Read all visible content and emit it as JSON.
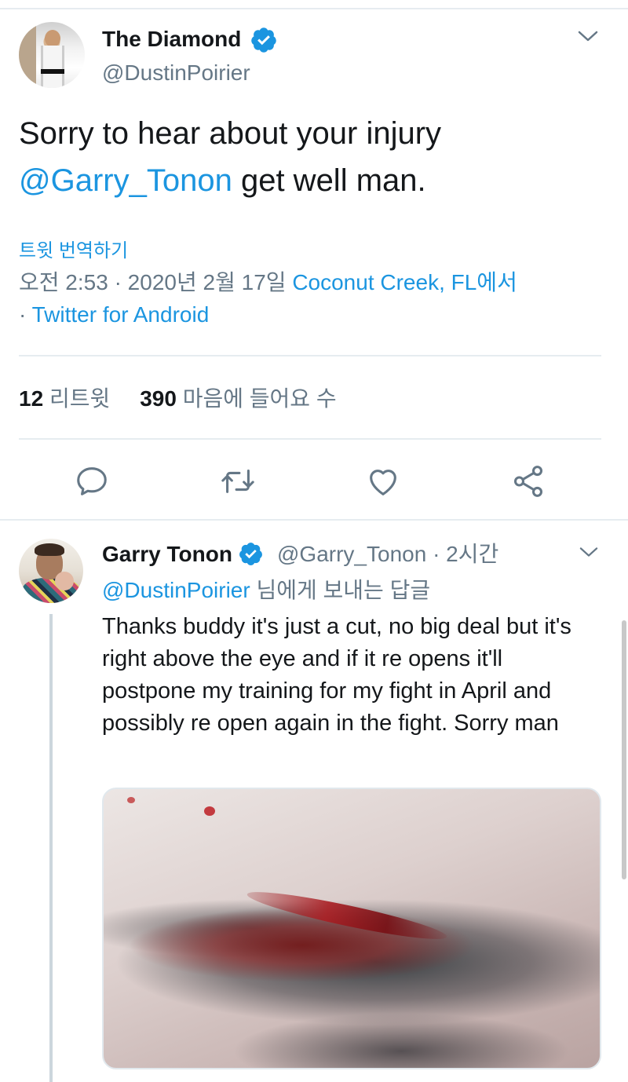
{
  "main_tweet": {
    "display_name": "The Diamond",
    "handle": "@DustinPoirier",
    "text_part1": "Sorry to hear about your injury ",
    "mention": "@Garry_Tonon",
    "text_part2": " get well man.",
    "translate_label": "트윗 번역하기",
    "timestamp": "오전 2:53 · 2020년 2월 17일 ",
    "location": "Coconut Creek, FL에서",
    "source_prefix": " · ",
    "source": "Twitter for Android",
    "retweets_count": "12",
    "retweets_label": "리트윗",
    "likes_count": "390",
    "likes_label": "마음에 들어요 수"
  },
  "reply_tweet": {
    "display_name": "Garry Tonon",
    "handle_time": "@Garry_Tonon · 2시간",
    "replying_to_mention": "@DustinPoirier",
    "replying_to_suffix": " 님에게 보내는 답글",
    "text": "Thanks buddy it's just a cut, no big deal but it's right above the eye and if it re opens it'll postpone my training for my fight in April and possibly re open again in the fight. Sorry man"
  },
  "icons": {
    "verified": "verified-badge-icon",
    "caret": "chevron-down-icon",
    "reply": "reply-icon",
    "retweet": "retweet-icon",
    "like": "heart-icon",
    "share": "share-icon"
  },
  "colors": {
    "accent": "#1b95e0",
    "muted": "#657786",
    "text": "#14171a",
    "divider": "#e6ecf0"
  }
}
